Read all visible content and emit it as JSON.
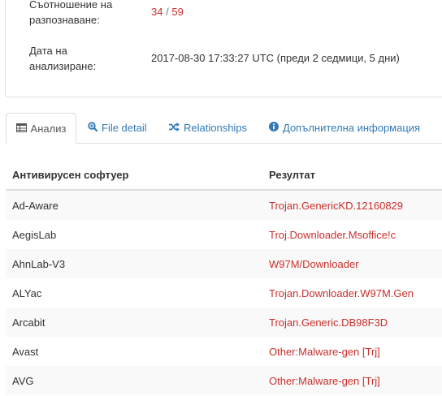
{
  "summary": {
    "ratio_label_line1": "Съотношение на",
    "ratio_label_line2": "разпознаване:",
    "ratio_detected": "34",
    "ratio_sep": "/",
    "ratio_total": "59",
    "date_label_line1": "Дата на",
    "date_label_line2": "анализиране:",
    "date_value": "2017-08-30 17:33:27 UTC (преди 2 седмици, 5 дни)"
  },
  "tabs": [
    {
      "label": "Анализ",
      "icon": "table-icon",
      "active": true
    },
    {
      "label": "File detail",
      "icon": "search-plus-icon",
      "active": false
    },
    {
      "label": "Relationships",
      "icon": "random-icon",
      "active": false
    },
    {
      "label": "Допълнителна информация",
      "icon": "info-circle-icon",
      "active": false
    }
  ],
  "table": {
    "headers": {
      "antivirus": "Антивирусен софтуер",
      "result": "Резултат"
    },
    "rows": [
      {
        "av": "Ad-Aware",
        "result": "Trojan.GenericKD.12160829"
      },
      {
        "av": "AegisLab",
        "result": "Troj.Downloader.Msoffice!c"
      },
      {
        "av": "AhnLab-V3",
        "result": "W97M/Downloader"
      },
      {
        "av": "ALYac",
        "result": "Trojan.Downloader.W97M.Gen"
      },
      {
        "av": "Arcabit",
        "result": "Trojan.Generic.DB98F3D"
      },
      {
        "av": "Avast",
        "result": "Other:Malware-gen [Trj]"
      },
      {
        "av": "AVG",
        "result": "Other:Malware-gen [Trj]"
      }
    ]
  },
  "colors": {
    "detected": "#c9302c",
    "link": "#337ab7",
    "text": "#333333"
  }
}
